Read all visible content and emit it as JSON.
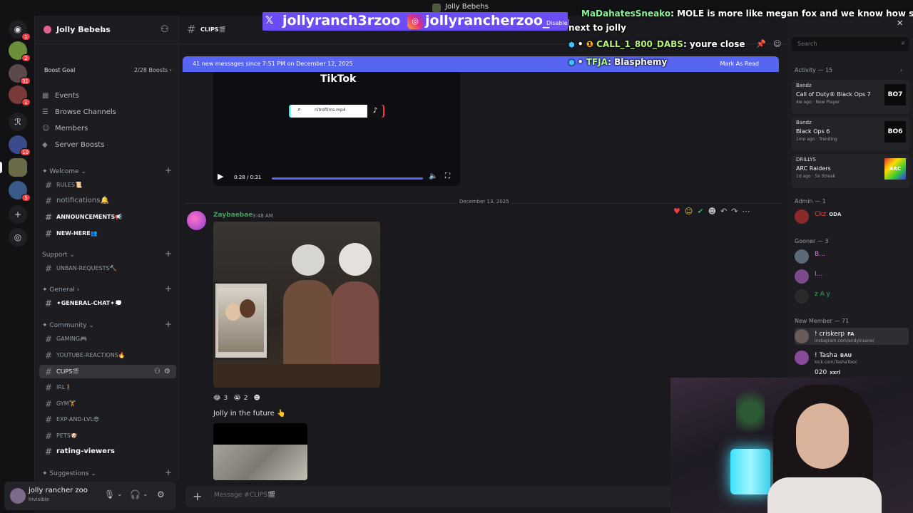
{
  "window": {
    "title": "Jolly Bebehs"
  },
  "servers": [
    {
      "name": "discord-home",
      "badge": "1"
    },
    {
      "name": "server-2",
      "badge": "2"
    },
    {
      "name": "server-3",
      "badge": "31"
    },
    {
      "name": "server-4",
      "badge": "1"
    },
    {
      "name": "server-5",
      "badge": ""
    },
    {
      "name": "server-6",
      "badge": "10"
    },
    {
      "name": "jolly-bebehs",
      "badge": ""
    },
    {
      "name": "server-8",
      "badge": "5"
    }
  ],
  "guild": {
    "name": "Jolly Bebehs",
    "chevron": "⌄"
  },
  "boost": {
    "label": "Boost Goal",
    "progress": "2/28 Boosts"
  },
  "nav": [
    {
      "icon": "calendar-icon",
      "glyph": "▦",
      "label": "Events"
    },
    {
      "icon": "browse-icon",
      "glyph": "☰",
      "label": "Browse Channels"
    },
    {
      "icon": "members-icon",
      "glyph": "☺",
      "label": "Members"
    },
    {
      "icon": "boost-icon",
      "glyph": "◆",
      "label": "Server Boosts"
    }
  ],
  "categories": {
    "welcome": "✦ Welcome",
    "support": "Support",
    "general": "✦ General",
    "community": "✦ Community",
    "suggestions": "✦ Suggestions"
  },
  "channels": {
    "rules": "RULES📜",
    "notifications": "notifications🔔",
    "announcements": "ANNOUNCEMENTS📢",
    "new_here": "NEW-HERE👥",
    "unban": "UNBAN-REQUESTS🔨",
    "general_chat": "✦GENERAL-CHAT✦💭",
    "gaming": "GAMING🎮",
    "youtube": "YOUTUBE-REACTIONS🔥",
    "clips": "CLIPS🎬",
    "irl": "IRL🚶",
    "gym": "GYM🏋",
    "exp": "EXP-AND-LVL😎",
    "pets": "PETS🐶",
    "rating": "rating-viewers"
  },
  "user": {
    "name": "jolly rancher zoo",
    "status": "Invisible"
  },
  "channel_header": {
    "name": "CLIPS🎬"
  },
  "new_messages": {
    "text": "41 new messages since 7:51 PM on December 12, 2025",
    "action": "Mark As Read"
  },
  "video": {
    "title": "TikTok",
    "search_text": "nitrofilms.mp4",
    "time": "0:28 / 0:31",
    "progress_fraction": 0.9
  },
  "divider": {
    "date": "December 13, 2025"
  },
  "message": {
    "author": "Zaybaebae",
    "time": "3:48 AM",
    "reactions": [
      {
        "emoji": "😂",
        "count": "3"
      },
      {
        "emoji": "😭",
        "count": "2"
      }
    ],
    "text": "Jolly in the future 👆"
  },
  "composer": {
    "placeholder": "Message #CLIPS🎬"
  },
  "members_panel": {
    "search_placeholder": "Search",
    "activity_header": "Activity — 15",
    "activities": [
      {
        "user": "Bandz",
        "game": "Call of Duty® Black Ops 7",
        "meta": "4w ago · New Player",
        "art": "BO7"
      },
      {
        "user": "Bandz",
        "game": "Black Ops 6",
        "meta": "1mo ago · Trending",
        "art": "BO6"
      },
      {
        "user": "DRILLYS",
        "game": "ARC Raiders",
        "meta": "1d ago · 5x Streak",
        "art": "ARC"
      }
    ],
    "admin_header": "Admin — 1",
    "admin": [
      {
        "name": "Ckz",
        "tag": "ODA",
        "color": "#f23f43"
      }
    ],
    "gooner_header": "Gooner — 3",
    "gooners": [
      {
        "name": "B...",
        "color": "#e86ae8"
      },
      {
        "name": "I...",
        "color": "#e86ae8"
      },
      {
        "name": "z A y",
        "color": "#3ba55d"
      }
    ],
    "newmember_header": "New Member — 71",
    "new_members": [
      {
        "name": "! criskerp",
        "tag": "FA",
        "sub": "instagram.com/andyinsane/"
      },
      {
        "name": "! Tasha",
        "tag": "BAU",
        "sub": "kick.com/TashaToxic"
      },
      {
        "name": "020",
        "tag": "xxrl",
        "sub": ""
      }
    ]
  },
  "overlay": {
    "x_handle": "jollyranch3rzoo",
    "ig_handle": "jollyrancherzoo_",
    "disable": "Disable",
    "chat": [
      {
        "user": "MaDahatesSneako",
        "text": ": MOLE is more like megan fox and we know how she looks"
      },
      {
        "user": "",
        "text": "next to jolly"
      },
      {
        "user": "CALL_1_800_DABS",
        "text": ": youre close"
      },
      {
        "user": "TFJA",
        "text": ": Blasphemy"
      }
    ]
  }
}
